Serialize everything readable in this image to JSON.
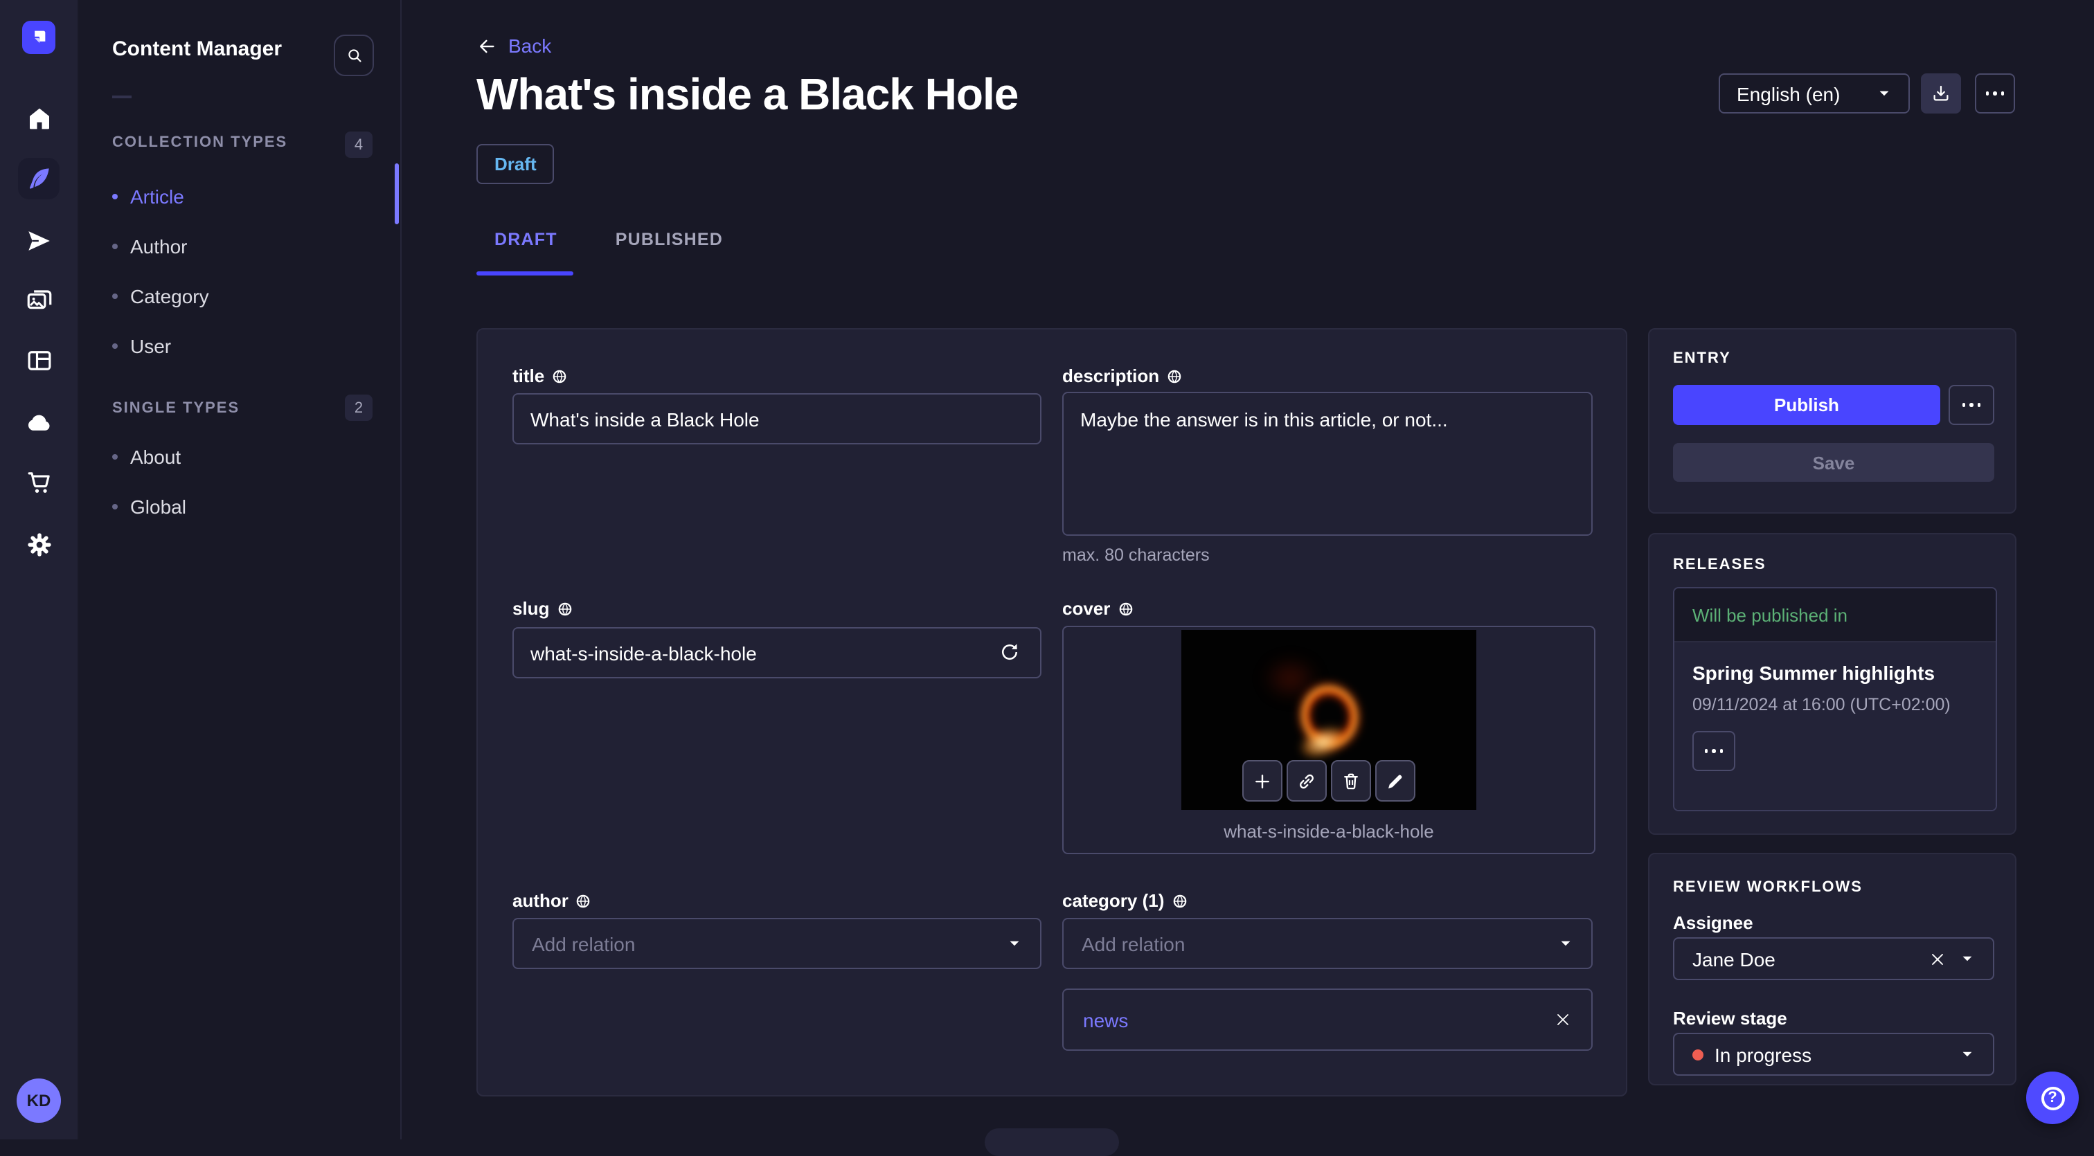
{
  "rail": {
    "workspace_initials": "KD"
  },
  "nav": {
    "title": "Content Manager",
    "collection_types": {
      "label": "COLLECTION TYPES",
      "count": "4",
      "items": [
        "Article",
        "Author",
        "Category",
        "User"
      ]
    },
    "single_types": {
      "label": "SINGLE TYPES",
      "count": "2",
      "items": [
        "About",
        "Global"
      ]
    }
  },
  "header": {
    "back_label": "Back",
    "title": "What's inside a Black Hole",
    "status": "Draft",
    "tabs": [
      "DRAFT",
      "PUBLISHED"
    ],
    "locale": "English (en)"
  },
  "form": {
    "title": {
      "label": "title",
      "value": "What's inside a Black Hole"
    },
    "description": {
      "label": "description",
      "value": "Maybe the answer is in this article, or not...",
      "hint": "max. 80 characters"
    },
    "slug": {
      "label": "slug",
      "value": "what-s-inside-a-black-hole"
    },
    "cover": {
      "label": "cover",
      "filename": "what-s-inside-a-black-hole"
    },
    "author": {
      "label": "author",
      "placeholder": "Add relation"
    },
    "category": {
      "label": "category (1)",
      "placeholder": "Add relation",
      "relations": [
        "news"
      ]
    }
  },
  "entry": {
    "title": "ENTRY",
    "publish": "Publish",
    "save": "Save"
  },
  "releases": {
    "title": "RELEASES",
    "status": "Will be published in",
    "name": "Spring Summer highlights",
    "date": "09/11/2024 at 16:00 (UTC+02:00)"
  },
  "review": {
    "title": "REVIEW WORKFLOWS",
    "assignee_label": "Assignee",
    "assignee_value": "Jane Doe",
    "stage_label": "Review stage",
    "stage_value": "In progress"
  },
  "colors": {
    "primary": "#4945ff",
    "primary_light": "#7b79ff",
    "draft_text": "#66b7f1",
    "success": "#5cb176",
    "danger": "#ee5e52",
    "surface": "#212134",
    "background": "#181826"
  }
}
